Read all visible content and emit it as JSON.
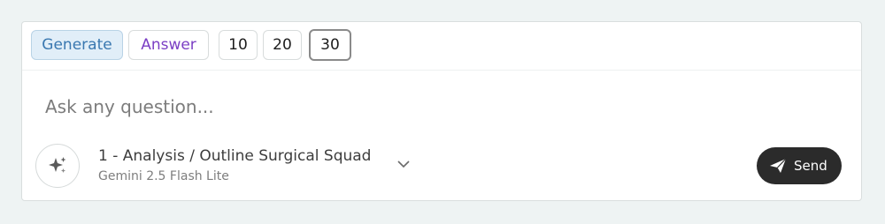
{
  "toolbar": {
    "generate_label": "Generate",
    "answer_label": "Answer",
    "count_options": [
      "10",
      "20",
      "30"
    ],
    "selected_count": "30"
  },
  "input": {
    "placeholder": "Ask any question..."
  },
  "model": {
    "title": "1 - Analysis / Outline Surgical Squad",
    "subtitle": "Gemini 2.5 Flash Lite",
    "icon": "sparkles-icon"
  },
  "send": {
    "label": "Send",
    "icon": "paper-plane-icon"
  },
  "colors": {
    "generate_text": "#3a78b0",
    "answer_text": "#7b3fc4",
    "send_bg": "#2b2b2b"
  }
}
